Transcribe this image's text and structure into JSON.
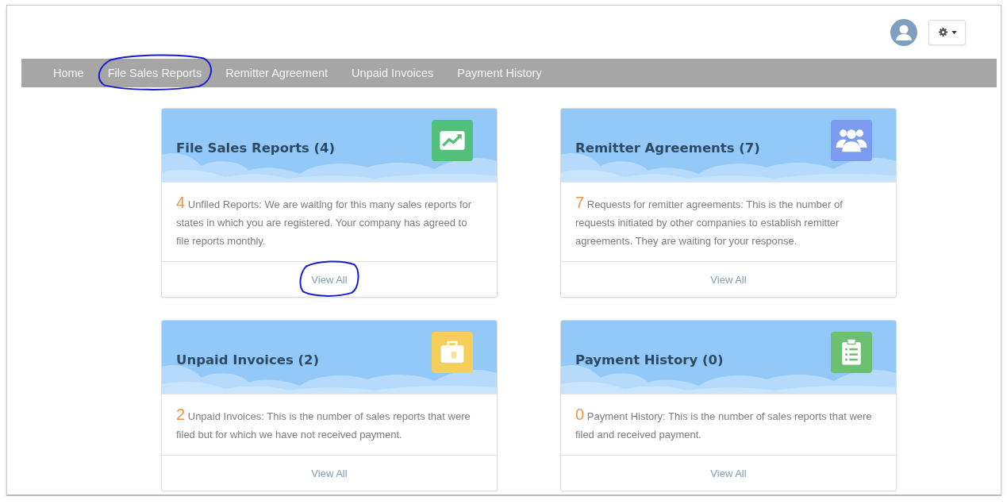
{
  "nav": [
    {
      "label": "Home",
      "circled": false
    },
    {
      "label": "File Sales Reports",
      "circled": true
    },
    {
      "label": "Remitter Agreement",
      "circled": false
    },
    {
      "label": "Unpaid Invoices",
      "circled": false
    },
    {
      "label": "Payment History",
      "circled": false
    }
  ],
  "cards": [
    {
      "title": "File Sales Reports (4)",
      "kind": "chart",
      "color": "#52c07a",
      "count": "4",
      "description": "Unfiled Reports: We are waiting for this many sales reports for states in which you are registered. Your company has agreed to file reports monthly.",
      "link": "View All",
      "link_circled": true
    },
    {
      "title": "Remitter Agreements (7)",
      "kind": "users",
      "color": "#7b9cf0",
      "count": "7",
      "description": "Requests for remitter agreements: This is the number of requests initiated by other companies to establish remitter agreements. They are waiting for your response.",
      "link": "View All",
      "link_circled": false
    },
    {
      "title": "Unpaid Invoices (2)",
      "kind": "briefcase",
      "color": "#f5cf5a",
      "count": "2",
      "description": "Unpaid Invoices: This is the number of sales reports that were filed but for which we have not received payment.",
      "link": "View All",
      "link_circled": false
    },
    {
      "title": "Payment History (0)",
      "kind": "clipboard",
      "color": "#6cc070",
      "count": "0",
      "description": "Payment History: This is the number of sales reports that were filed and received payment.",
      "link": "View All",
      "link_circled": false
    }
  ]
}
